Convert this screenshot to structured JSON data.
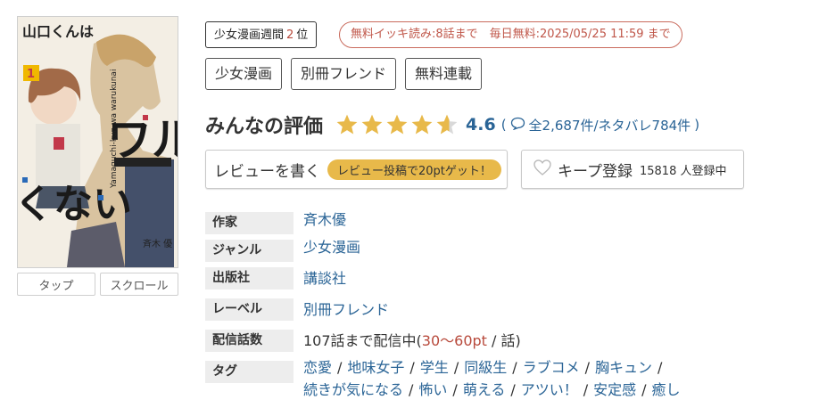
{
  "cover": {
    "title_text": "山口くんはワルくない",
    "volume": "1",
    "romaji": "Yamaguchi-kun wa warukunai",
    "author_text": "斉木 優",
    "tabs": [
      "タップ",
      "スクロール"
    ]
  },
  "rank_badge": {
    "prefix": "少女漫画週間",
    "number": "2",
    "suffix": "位"
  },
  "free_badge": "無料イッキ読み:8話まで　毎日無料:2025/05/25 11:59 まで",
  "chips": [
    "少女漫画",
    "別冊フレンド",
    "無料連載"
  ],
  "rating": {
    "title": "みんなの評価",
    "value": 4.6,
    "score_text": "4.6",
    "open_paren": "(",
    "count_text": "全2,687件/ネタバレ784件",
    "close_paren": ")",
    "star_color": "#e8b94a",
    "star_empty_color": "#d9d9d9"
  },
  "review_button": {
    "label": "レビューを書く",
    "promo": "レビュー投稿で20ptゲット！"
  },
  "keep_button": {
    "label": "キープ登録",
    "count": "15818 人登録中"
  },
  "info": {
    "author": {
      "label": "作家",
      "value": "斉木優"
    },
    "genre": {
      "label": "ジャンル",
      "value": "少女漫画"
    },
    "publisher": {
      "label": "出版社",
      "value": "講談社"
    },
    "label_row": {
      "label": "レーベル",
      "value": "別冊フレンド"
    },
    "episodes": {
      "label": "配信話数",
      "prefix": "107話まで配信中(",
      "price": "30〜60pt",
      "suffix": " / 話)"
    },
    "tags": {
      "label": "タグ",
      "items": [
        "恋愛",
        "地味女子",
        "学生",
        "同級生",
        "ラブコメ",
        "胸キュン",
        "続きが気になる",
        "怖い",
        "萌える",
        "アツい！",
        "安定感",
        "癒し"
      ]
    }
  },
  "colors": {
    "link": "#2a6496",
    "accent_red": "#b84a3c",
    "promo_bg": "#e8b94a"
  }
}
